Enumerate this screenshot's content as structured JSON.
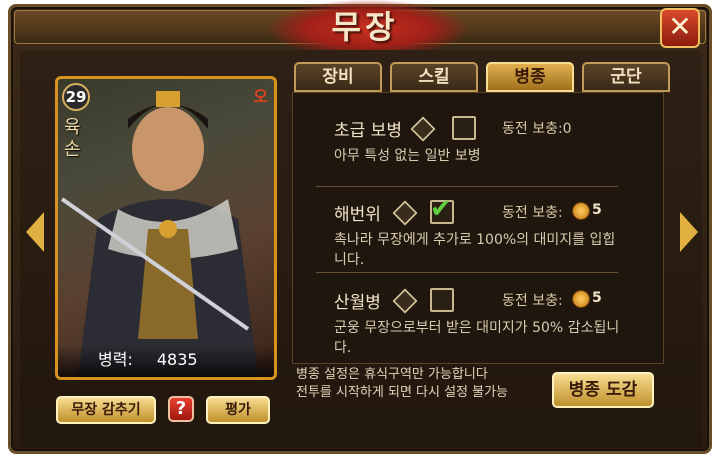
{
  "header": {
    "title": "무장",
    "close_icon": "x-close-icon"
  },
  "hero": {
    "level": "29",
    "faction": "오",
    "name": "육손",
    "power_label": "병력:",
    "power_value": "4835"
  },
  "tabs": [
    {
      "label": "장비",
      "active": false
    },
    {
      "label": "스킬",
      "active": false
    },
    {
      "label": "병종",
      "active": true
    },
    {
      "label": "군단",
      "active": false
    }
  ],
  "units": [
    {
      "name": "초급 보병",
      "checked": false,
      "cost_label": "동전 보충:0",
      "cost_value": "",
      "description": "아무 특성 없는 일반 보병"
    },
    {
      "name": "해번위",
      "checked": true,
      "cost_label": "동전 보충:",
      "cost_value": "5",
      "description": "촉나라 무장에게 추가로 100%의 대미지를 입힙니다."
    },
    {
      "name": "산월병",
      "checked": false,
      "cost_label": "동전 보충:",
      "cost_value": "5",
      "description": "군웅 무장으로부터 받은 대미지가 50% 감소됩니다."
    }
  ],
  "notes": [
    "병종 설정은 휴식구역만 가능합니다",
    "전투를 시작하게 되면 다시 설정 불가능"
  ],
  "buttons": {
    "hide": "무장 감추기",
    "help": "?",
    "rate": "평가",
    "guide": "병종 도감"
  },
  "colors": {
    "accent": "#e0b050",
    "frame": "#3b2a1a",
    "close": "#c83020"
  }
}
